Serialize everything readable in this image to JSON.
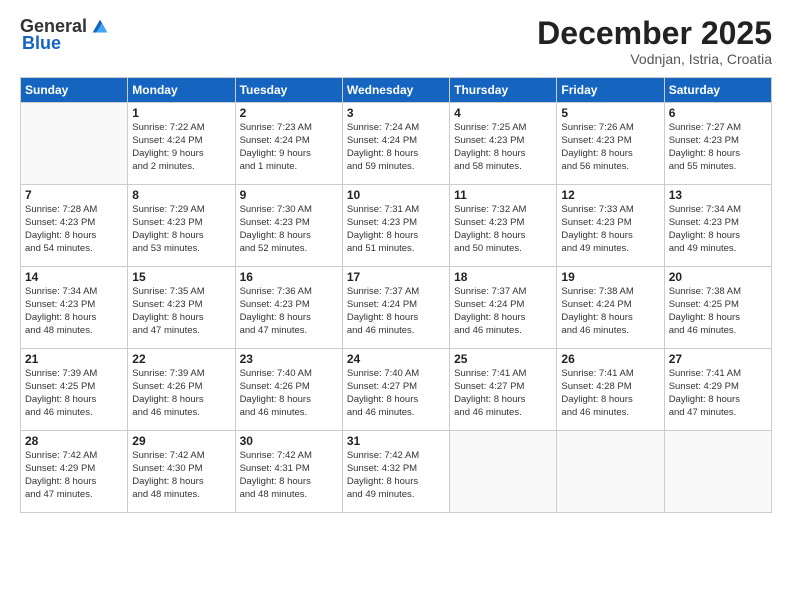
{
  "header": {
    "logo_general": "General",
    "logo_blue": "Blue",
    "month": "December 2025",
    "location": "Vodnjan, Istria, Croatia"
  },
  "days_of_week": [
    "Sunday",
    "Monday",
    "Tuesday",
    "Wednesday",
    "Thursday",
    "Friday",
    "Saturday"
  ],
  "weeks": [
    [
      {
        "day": "",
        "info": ""
      },
      {
        "day": "1",
        "info": "Sunrise: 7:22 AM\nSunset: 4:24 PM\nDaylight: 9 hours\nand 2 minutes."
      },
      {
        "day": "2",
        "info": "Sunrise: 7:23 AM\nSunset: 4:24 PM\nDaylight: 9 hours\nand 1 minute."
      },
      {
        "day": "3",
        "info": "Sunrise: 7:24 AM\nSunset: 4:24 PM\nDaylight: 8 hours\nand 59 minutes."
      },
      {
        "day": "4",
        "info": "Sunrise: 7:25 AM\nSunset: 4:23 PM\nDaylight: 8 hours\nand 58 minutes."
      },
      {
        "day": "5",
        "info": "Sunrise: 7:26 AM\nSunset: 4:23 PM\nDaylight: 8 hours\nand 56 minutes."
      },
      {
        "day": "6",
        "info": "Sunrise: 7:27 AM\nSunset: 4:23 PM\nDaylight: 8 hours\nand 55 minutes."
      }
    ],
    [
      {
        "day": "7",
        "info": "Sunrise: 7:28 AM\nSunset: 4:23 PM\nDaylight: 8 hours\nand 54 minutes."
      },
      {
        "day": "8",
        "info": "Sunrise: 7:29 AM\nSunset: 4:23 PM\nDaylight: 8 hours\nand 53 minutes."
      },
      {
        "day": "9",
        "info": "Sunrise: 7:30 AM\nSunset: 4:23 PM\nDaylight: 8 hours\nand 52 minutes."
      },
      {
        "day": "10",
        "info": "Sunrise: 7:31 AM\nSunset: 4:23 PM\nDaylight: 8 hours\nand 51 minutes."
      },
      {
        "day": "11",
        "info": "Sunrise: 7:32 AM\nSunset: 4:23 PM\nDaylight: 8 hours\nand 50 minutes."
      },
      {
        "day": "12",
        "info": "Sunrise: 7:33 AM\nSunset: 4:23 PM\nDaylight: 8 hours\nand 49 minutes."
      },
      {
        "day": "13",
        "info": "Sunrise: 7:34 AM\nSunset: 4:23 PM\nDaylight: 8 hours\nand 49 minutes."
      }
    ],
    [
      {
        "day": "14",
        "info": "Sunrise: 7:34 AM\nSunset: 4:23 PM\nDaylight: 8 hours\nand 48 minutes."
      },
      {
        "day": "15",
        "info": "Sunrise: 7:35 AM\nSunset: 4:23 PM\nDaylight: 8 hours\nand 47 minutes."
      },
      {
        "day": "16",
        "info": "Sunrise: 7:36 AM\nSunset: 4:23 PM\nDaylight: 8 hours\nand 47 minutes."
      },
      {
        "day": "17",
        "info": "Sunrise: 7:37 AM\nSunset: 4:24 PM\nDaylight: 8 hours\nand 46 minutes."
      },
      {
        "day": "18",
        "info": "Sunrise: 7:37 AM\nSunset: 4:24 PM\nDaylight: 8 hours\nand 46 minutes."
      },
      {
        "day": "19",
        "info": "Sunrise: 7:38 AM\nSunset: 4:24 PM\nDaylight: 8 hours\nand 46 minutes."
      },
      {
        "day": "20",
        "info": "Sunrise: 7:38 AM\nSunset: 4:25 PM\nDaylight: 8 hours\nand 46 minutes."
      }
    ],
    [
      {
        "day": "21",
        "info": "Sunrise: 7:39 AM\nSunset: 4:25 PM\nDaylight: 8 hours\nand 46 minutes."
      },
      {
        "day": "22",
        "info": "Sunrise: 7:39 AM\nSunset: 4:26 PM\nDaylight: 8 hours\nand 46 minutes."
      },
      {
        "day": "23",
        "info": "Sunrise: 7:40 AM\nSunset: 4:26 PM\nDaylight: 8 hours\nand 46 minutes."
      },
      {
        "day": "24",
        "info": "Sunrise: 7:40 AM\nSunset: 4:27 PM\nDaylight: 8 hours\nand 46 minutes."
      },
      {
        "day": "25",
        "info": "Sunrise: 7:41 AM\nSunset: 4:27 PM\nDaylight: 8 hours\nand 46 minutes."
      },
      {
        "day": "26",
        "info": "Sunrise: 7:41 AM\nSunset: 4:28 PM\nDaylight: 8 hours\nand 46 minutes."
      },
      {
        "day": "27",
        "info": "Sunrise: 7:41 AM\nSunset: 4:29 PM\nDaylight: 8 hours\nand 47 minutes."
      }
    ],
    [
      {
        "day": "28",
        "info": "Sunrise: 7:42 AM\nSunset: 4:29 PM\nDaylight: 8 hours\nand 47 minutes."
      },
      {
        "day": "29",
        "info": "Sunrise: 7:42 AM\nSunset: 4:30 PM\nDaylight: 8 hours\nand 48 minutes."
      },
      {
        "day": "30",
        "info": "Sunrise: 7:42 AM\nSunset: 4:31 PM\nDaylight: 8 hours\nand 48 minutes."
      },
      {
        "day": "31",
        "info": "Sunrise: 7:42 AM\nSunset: 4:32 PM\nDaylight: 8 hours\nand 49 minutes."
      },
      {
        "day": "",
        "info": ""
      },
      {
        "day": "",
        "info": ""
      },
      {
        "day": "",
        "info": ""
      }
    ]
  ]
}
